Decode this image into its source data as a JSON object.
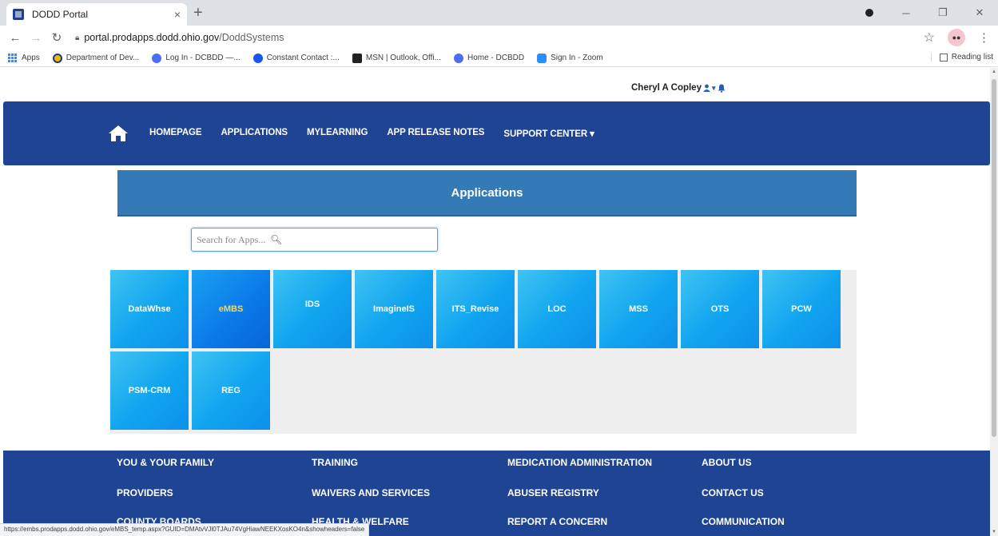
{
  "browser": {
    "tab_title": "DODD Portal",
    "tab_close": "×",
    "new_tab": "+",
    "url_host": "portal.prodapps.dodd.ohio.gov",
    "url_path": "/DoddSystems",
    "bookmarks": [
      {
        "label": "Apps",
        "icon": "apps-grid-icon"
      },
      {
        "label": "Department of Dev...",
        "icon": "ohio-seal-icon",
        "color": "#f2b705"
      },
      {
        "label": "Log In - DCBDD —...",
        "icon": "globe-icon",
        "color": "#4c6ef5"
      },
      {
        "label": "Constant Contact :...",
        "icon": "constant-contact-icon",
        "color": "#1856ed"
      },
      {
        "label": "MSN | Outlook, Offi...",
        "icon": "msn-icon",
        "color": "#222222"
      },
      {
        "label": "Home - DCBDD",
        "icon": "globe-icon",
        "color": "#4c6ef5"
      },
      {
        "label": "Sign In - Zoom",
        "icon": "zoom-icon",
        "color": "#2d8cff"
      }
    ],
    "reading_list": "Reading list",
    "status_url": "https://embs.prodapps.dodd.ohio.gov/eMBS_temp.aspx?GUID=DMAtvVJl0TJAu74VgHiawNEEKXosKO4n&showheaders=false"
  },
  "header": {
    "user_name": "Cheryl A Copley",
    "user_icons": "▾"
  },
  "nav": {
    "items": [
      "HOMEPAGE",
      "APPLICATIONS",
      "MYLEARNING",
      "APP RELEASE NOTES",
      "SUPPORT CENTER ▾"
    ]
  },
  "main": {
    "heading": "Applications",
    "search_placeholder": "Search for Apps..."
  },
  "apps": [
    {
      "label": "DataWhse"
    },
    {
      "label": "eMBS",
      "active": true
    },
    {
      "label": "IDS"
    },
    {
      "label": "ImagineIS"
    },
    {
      "label": "ITS_Revise"
    },
    {
      "label": "LOC"
    },
    {
      "label": "MSS"
    },
    {
      "label": "OTS"
    },
    {
      "label": "PCW"
    },
    {
      "label": "PSM-CRM"
    },
    {
      "label": "REG"
    }
  ],
  "footer": {
    "columns": [
      [
        "YOU & YOUR FAMILY",
        "PROVIDERS",
        "COUNTY BOARDS"
      ],
      [
        "TRAINING",
        "WAIVERS AND SERVICES",
        "HEALTH & WELFARE"
      ],
      [
        "MEDICATION ADMINISTRATION",
        "ABUSER REGISTRY",
        "REPORT A CONCERN"
      ],
      [
        "ABOUT US",
        "CONTACT US",
        "COMMUNICATION"
      ]
    ]
  },
  "colors": {
    "nav_bg": "#1f4494",
    "header_bg": "#347ab6",
    "tile_blue": "#10a4ef",
    "active_label": "#ffd54a"
  }
}
